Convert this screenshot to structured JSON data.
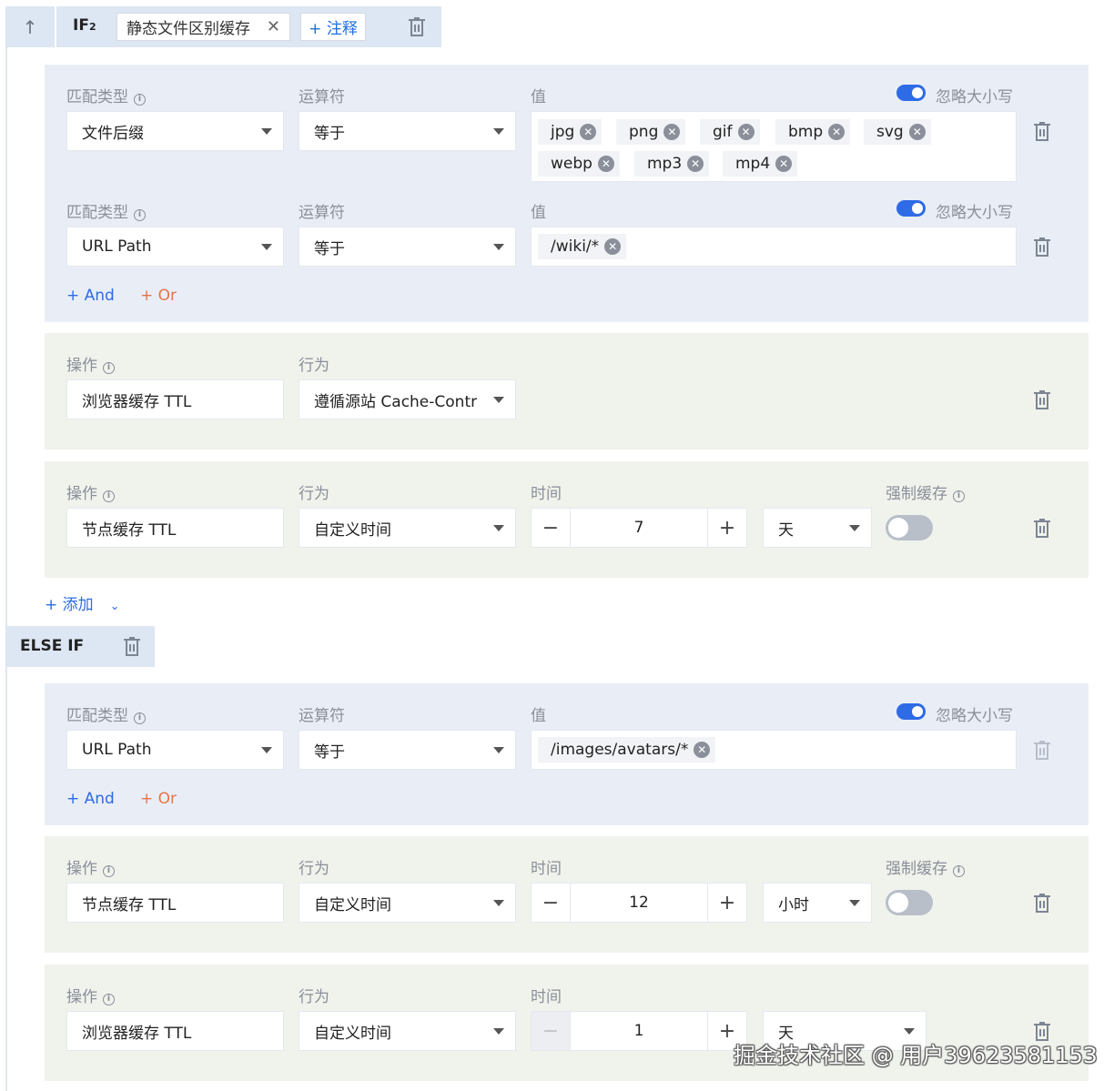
{
  "if_bar": {
    "label": "IF",
    "index": "2",
    "name": "静态文件区别缓存",
    "note_label": "+ 注释"
  },
  "labels": {
    "match_type": "匹配类型",
    "operator": "运算符",
    "value": "值",
    "ignore_case": "忽略大小写",
    "operation": "操作",
    "behavior": "行为",
    "time": "时间",
    "force_cache": "强制缓存",
    "and": "+ And",
    "or": "+ Or",
    "add": "+ 添加"
  },
  "if_conditions": [
    {
      "match_type": "文件后缀",
      "operator": "等于",
      "tags": [
        "jpg",
        "png",
        "gif",
        "bmp",
        "svg",
        "webp",
        "mp3",
        "mp4"
      ],
      "ignore_case": true
    },
    {
      "match_type": "URL Path",
      "operator": "等于",
      "tags": [
        "/wiki/*"
      ],
      "ignore_case": true
    }
  ],
  "if_actions": [
    {
      "operation": "浏览器缓存 TTL",
      "behavior": "遵循源站 Cache-Contr"
    },
    {
      "operation": "节点缓存 TTL",
      "behavior": "自定义时间",
      "time_value": "7",
      "time_unit": "天",
      "force_cache": false
    }
  ],
  "else_bar": {
    "label": "ELSE IF"
  },
  "else_conditions": [
    {
      "match_type": "URL Path",
      "operator": "等于",
      "tags": [
        "/images/avatars/*"
      ],
      "ignore_case": true
    }
  ],
  "else_actions": [
    {
      "operation": "节点缓存 TTL",
      "behavior": "自定义时间",
      "time_value": "12",
      "time_unit": "小时",
      "force_cache": false
    },
    {
      "operation": "浏览器缓存 TTL",
      "behavior": "自定义时间",
      "time_value": "1",
      "time_unit": "天"
    }
  ],
  "stepper": {
    "minus": "−",
    "plus": "+"
  },
  "watermark": "掘金技术社区 @ 用户3962358115З",
  "colors": {
    "accent": "#2e6be6",
    "or": "#e8734a",
    "condition_bg": "#e9eef6",
    "action_bg": "#f0f3ec"
  }
}
